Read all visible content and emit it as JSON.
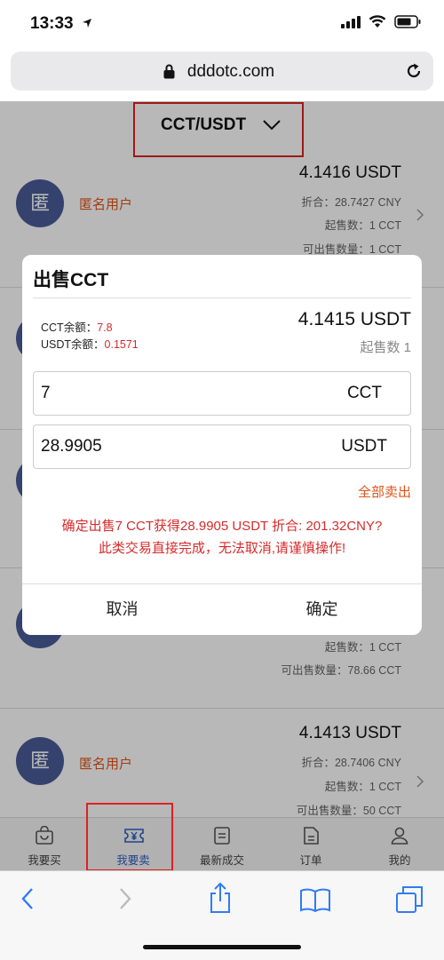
{
  "status_bar": {
    "time": "13:33"
  },
  "browser": {
    "url": "dddotc.com"
  },
  "pair_selector": {
    "label": "CCT/USDT"
  },
  "listings": [
    {
      "avatar": "匿",
      "seller": "匿名用户",
      "price": "4.1416 USDT",
      "rate": "折合：28.7427 CNY",
      "min": "起售数：1 CCT",
      "available": "可出售数量：1 CCT"
    },
    {
      "avatar": "匿",
      "seller": "",
      "price": "",
      "rate": "",
      "min": "起售数：1 CCT",
      "available": "可出售数量：78.66 CCT"
    },
    {
      "avatar": "匿",
      "seller": "匿名用户",
      "price": "4.1413 USDT",
      "rate": "折合：28.7406 CNY",
      "min": "起售数：1 CCT",
      "available": "可出售数量：50 CCT"
    }
  ],
  "modal": {
    "title": "出售CCT",
    "cct_balance_label": "CCT余额：",
    "cct_balance_value": "7.8",
    "usdt_balance_label": "USDT余额：",
    "usdt_balance_value": "0.1571",
    "price": "4.1415 USDT",
    "min_label": "起售数 1",
    "amount_value": "7",
    "amount_unit": "CCT",
    "total_value": "28.9905",
    "total_unit": "USDT",
    "sell_all": "全部卖出",
    "confirm_line1": "确定出售7 CCT获得28.9905 USDT 折合: 201.32CNY?",
    "confirm_line2": "此类交易直接完成，无法取消,请谨慎操作!",
    "cancel": "取消",
    "ok": "确定"
  },
  "tabs": [
    {
      "label": "我要买",
      "icon": "shopping-bag-icon"
    },
    {
      "label": "我要卖",
      "icon": "yen-ticket-icon",
      "active": true
    },
    {
      "label": "最新成交",
      "icon": "document-icon"
    },
    {
      "label": "订单",
      "icon": "order-icon"
    },
    {
      "label": "我的",
      "icon": "person-icon"
    }
  ],
  "colors": {
    "accent": "#2f5fbf",
    "seller": "#e0541a",
    "warning": "#d62b2b",
    "highlight_box": "#e02020"
  }
}
